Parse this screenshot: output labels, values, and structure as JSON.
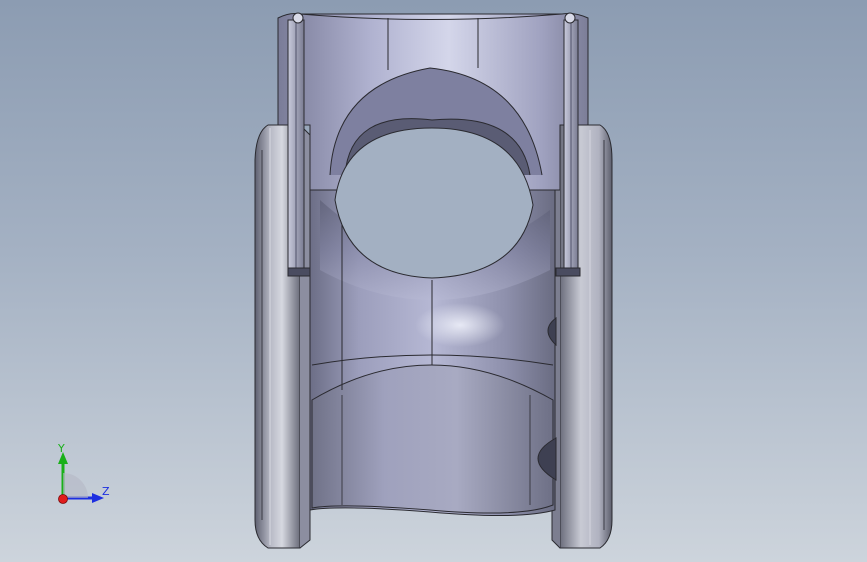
{
  "viewport": {
    "background_top": "#8c9cb2",
    "background_bottom": "#cdd4dc"
  },
  "triad": {
    "y_label": "Y",
    "z_label": "Z",
    "y_color": "#19b019",
    "z_color": "#1c2ee0",
    "x_color": "#e01c1c"
  },
  "model": {
    "part_color": "#8a8ea8"
  }
}
